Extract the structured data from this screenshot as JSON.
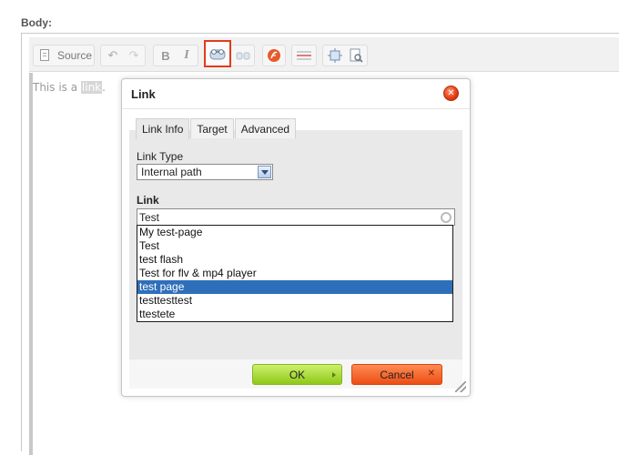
{
  "field": {
    "label": "Body:"
  },
  "toolbar": {
    "source_label": "Source",
    "buttons": [
      {
        "name": "undo",
        "icon": "undo-icon",
        "glyph": "↶"
      },
      {
        "name": "redo",
        "icon": "redo-icon",
        "glyph": "↷"
      },
      {
        "name": "bold",
        "icon": "bold-icon",
        "glyph": "B"
      },
      {
        "name": "italic",
        "icon": "italic-icon",
        "glyph": "I"
      },
      {
        "name": "link",
        "icon": "link-icon",
        "highlighted": true
      },
      {
        "name": "unlink",
        "icon": "unlink-icon"
      },
      {
        "name": "flash",
        "icon": "flash-icon"
      },
      {
        "name": "horizontal-rule",
        "icon": "horizontal-rule-icon"
      },
      {
        "name": "maximize",
        "icon": "maximize-icon"
      },
      {
        "name": "preview",
        "icon": "preview-icon"
      }
    ],
    "highlight_color": "#e13b20"
  },
  "content": {
    "before": "This is a ",
    "selected": "link",
    "after": "."
  },
  "dialog": {
    "title": "Link",
    "tabs": [
      "Link Info",
      "Target",
      "Advanced"
    ],
    "active_tab": "Link Info",
    "link_type_label": "Link Type",
    "link_type_value": "Internal path",
    "link_label": "Link",
    "link_value": "Test",
    "suggestions": [
      "My test-page",
      "Test",
      "test flash",
      "Test for flv & mp4 player",
      "test page",
      "testtesttest",
      "ttestete"
    ],
    "selected_suggestion": "test page",
    "ok_label": "OK",
    "cancel_label": "Cancel",
    "colors": {
      "ok": "#9bd22a",
      "cancel": "#f2642a",
      "selection": "#2f6fba",
      "close": "#e23b10"
    }
  }
}
